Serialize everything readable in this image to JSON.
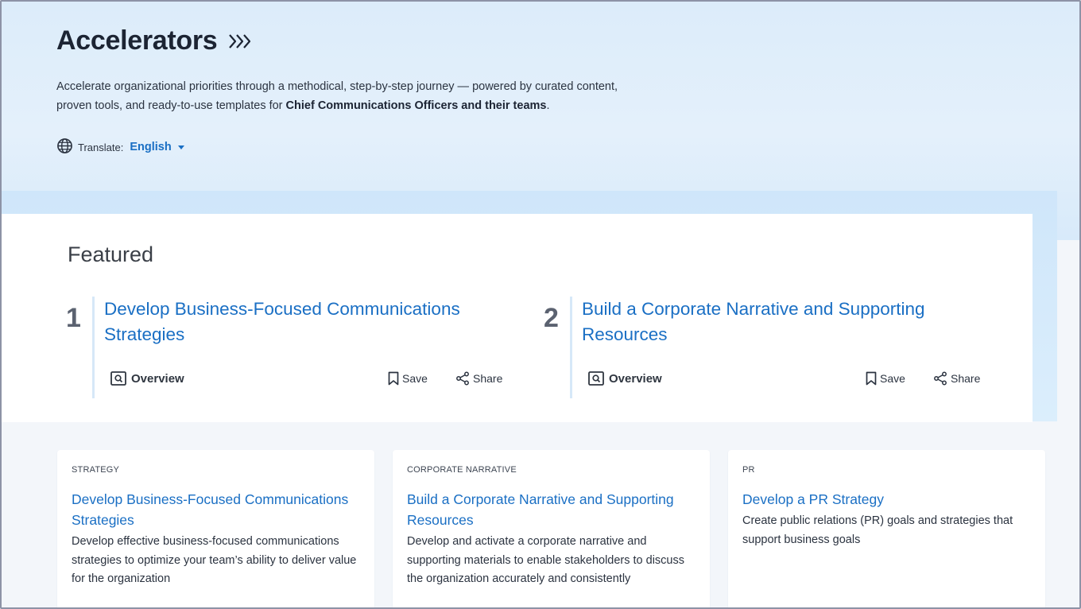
{
  "header": {
    "title": "Accelerators",
    "intro_prefix": "Accelerate organizational priorities through a methodical, step-by-step journey — powered by curated content, proven tools, and ready-to-use templates for ",
    "intro_bold": "Chief Communications Officers and their teams",
    "intro_suffix": ".",
    "translate_label": "Translate:",
    "translate_value": "English"
  },
  "featured": {
    "heading": "Featured",
    "items": [
      {
        "number": "1",
        "title": "Develop Business-Focused Communications Strategies",
        "overview": "Overview",
        "save": "Save",
        "share": "Share"
      },
      {
        "number": "2",
        "title": "Build a Corporate Narrative and Supporting Resources",
        "overview": "Overview",
        "save": "Save",
        "share": "Share"
      }
    ]
  },
  "cards": [
    {
      "category": "STRATEGY",
      "title": "Develop Business-Focused Communications Strategies",
      "description": "Develop effective business-focused communications strategies to optimize your team’s ability to deliver value for the organization"
    },
    {
      "category": "CORPORATE NARRATIVE",
      "title": "Build a Corporate Narrative and Supporting Resources",
      "description": "Develop and activate a corporate narrative and supporting materials to enable stakeholders to discuss the organization accurately and consistently"
    },
    {
      "category": "PR",
      "title": "Develop a PR Strategy",
      "description": "Create public relations (PR) goals and strategies that support business goals"
    }
  ],
  "colors": {
    "accent": "#1a6fc4",
    "hero_bg": "#dcecfa",
    "page_bg": "#f3f6fa"
  },
  "icons": [
    "chevrons-right-icon",
    "globe-icon",
    "caret-down-icon",
    "overview-icon",
    "bookmark-icon",
    "share-icon"
  ]
}
